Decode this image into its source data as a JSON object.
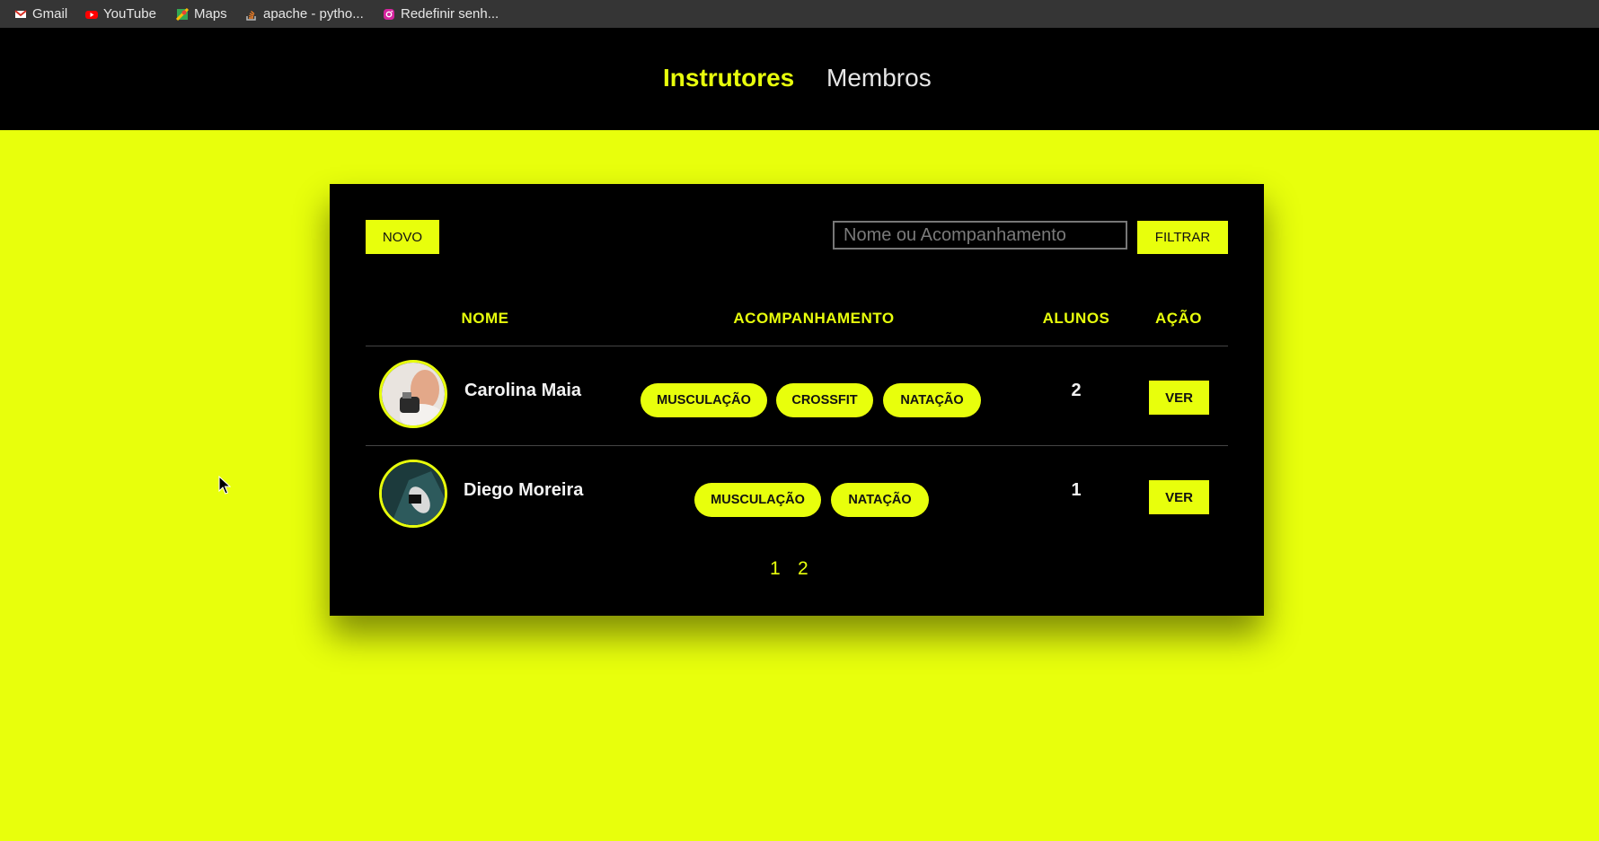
{
  "bookmarks": [
    {
      "label": "Gmail",
      "icon": "gmail-icon"
    },
    {
      "label": "YouTube",
      "icon": "youtube-icon"
    },
    {
      "label": "Maps",
      "icon": "maps-icon"
    },
    {
      "label": "apache - pytho...",
      "icon": "stackoverflow-icon"
    },
    {
      "label": "Redefinir senh...",
      "icon": "instagram-icon"
    }
  ],
  "nav": {
    "instrutores": "Instrutores",
    "membros": "Membros",
    "active": "Instrutores"
  },
  "toolbar": {
    "novo": "NOVO",
    "search_placeholder": "Nome ou Acompanhamento",
    "filtrar": "FILTRAR"
  },
  "table": {
    "headers": [
      "NOME",
      "ACOMPANHAMENTO",
      "ALUNOS",
      "AÇÃO"
    ],
    "rows": [
      {
        "name": "Carolina Maia",
        "tags": [
          "MUSCULAÇÃO",
          "CROSSFIT",
          "NATAÇÃO"
        ],
        "alunos": "2",
        "action": "VER"
      },
      {
        "name": "Diego Moreira",
        "tags": [
          "MUSCULAÇÃO",
          "NATAÇÃO"
        ],
        "alunos": "1",
        "action": "VER"
      }
    ]
  },
  "pagination": [
    "1",
    "2"
  ],
  "colors": {
    "accent": "#e8ff0c",
    "panel": "#000000",
    "topbar": "#353535"
  }
}
